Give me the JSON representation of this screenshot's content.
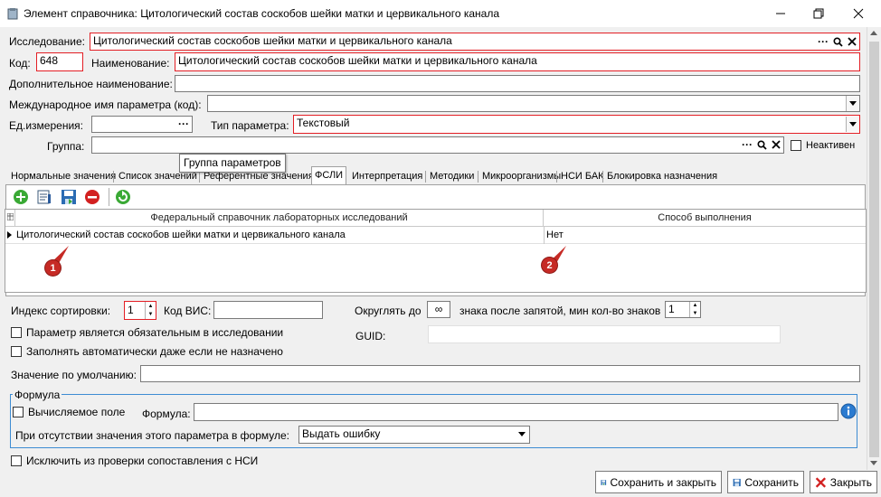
{
  "window": {
    "title": "Элемент справочника: Цитологический состав соскобов шейки матки и цервикального канала",
    "minimize_icon": "minimize-icon",
    "restore_icon": "restore-icon",
    "close_icon": "close-icon"
  },
  "form": {
    "study_label": "Исследование:",
    "study_value": "Цитологический состав соскобов шейки матки и цервикального канала",
    "code_label": "Код:",
    "code_value": "648",
    "name_label": "Наименование:",
    "name_value": "Цитологический состав соскобов шейки матки и цервикального канала",
    "extra_name_label": "Дополнительное наименование:",
    "extra_name_value": "",
    "intl_name_label": "Международное имя параметра (код):",
    "intl_name_value": "",
    "unit_label": "Ед.измерения:",
    "unit_value": "",
    "param_type_label": "Тип параметра:",
    "param_type_value": "Текстовый",
    "group_label": "Группа:",
    "group_value": "",
    "inactive_label": "Неактивен",
    "inactive_checked": false
  },
  "tooltip": {
    "text": "Группа параметров"
  },
  "tabs": [
    {
      "label": "Нормальные значения",
      "active": false
    },
    {
      "label": "Список значений",
      "active": false
    },
    {
      "label": "Референтные значения",
      "active": false
    },
    {
      "label": "ФСЛИ",
      "active": true
    },
    {
      "label": "Интерпретация",
      "active": false
    },
    {
      "label": "Методики",
      "active": false
    },
    {
      "label": "Микроорганизмы",
      "active": false
    },
    {
      "label": "НСИ БАК",
      "active": false
    },
    {
      "label": "Блокировка назначения",
      "active": false
    }
  ],
  "toolbar": {
    "icons": [
      "add-icon",
      "edit-icon",
      "save-icon",
      "delete-icon",
      "refresh-icon"
    ]
  },
  "grid": {
    "columns": [
      "Федеральный справочник лабораторных исследований",
      "Способ выполнения"
    ],
    "rows": [
      [
        "Цитологический состав соскобов шейки матки и цервикального канала",
        "Нет"
      ]
    ],
    "markers": [
      "1",
      "2"
    ]
  },
  "bottom": {
    "sort_index_label": "Индекс сортировки:",
    "sort_index_value": "1",
    "vis_code_label": "Код ВИС:",
    "vis_code_value": "",
    "round_label": "Округлять до",
    "round_value": "∞",
    "decimals_label": "знака после запятой, мин кол-во знаков",
    "decimals_value": "1",
    "required_param_label": "Параметр является обязательным в исследовании",
    "auto_fill_label": "Заполнять автоматически даже если не назначено",
    "guid_label": "GUID:",
    "guid_value": "",
    "default_value_label": "Значение по умолчанию:",
    "default_value": "",
    "formula_group_label": "Формула",
    "computed_field_label": "Вычисляемое поле",
    "formula_label": "Формула:",
    "formula_value": "",
    "missing_value_label": "При отсутствии значения этого параметра в формуле:",
    "missing_value_option": "Выдать ошибку",
    "exclude_nsi_label": "Исключить из проверки сопоставления с НСИ"
  },
  "buttons": {
    "save_close": "Сохранить и закрыть",
    "save": "Сохранить",
    "close": "Закрыть"
  },
  "colors": {
    "required_border": "#e31e24",
    "marker": "#c62a25",
    "group_border": "#3d8cd3"
  }
}
